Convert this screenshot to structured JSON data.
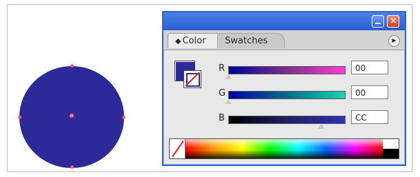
{
  "panel": {
    "tabs": [
      {
        "label": "Color",
        "active": true
      },
      {
        "label": "Swatches",
        "active": false
      }
    ],
    "menu_icon": "panel-menu-arrow-icon",
    "window_buttons": [
      "minimize-icon",
      "close-icon"
    ],
    "close_glyph": "×"
  },
  "fill_stroke": {
    "fill_color": "#2c2a98",
    "stroke_color": "none"
  },
  "channels": [
    {
      "label": "R",
      "value": "00",
      "level": 0.0
    },
    {
      "label": "G",
      "value": "00",
      "level": 0.0
    },
    {
      "label": "B",
      "value": "CC",
      "level": 0.8
    }
  ],
  "spectrum": {
    "none_icon": "none-swatch-icon",
    "colors": [
      "#ff0000",
      "#ff9900",
      "#ffff00",
      "#00ff00",
      "#00ffff",
      "#0066ff",
      "#ff00ff",
      "#ff0000"
    ]
  },
  "artwork": {
    "shape": "circle",
    "fill_color": "#2c2a98",
    "anchor_color": "#ff5a7a"
  }
}
